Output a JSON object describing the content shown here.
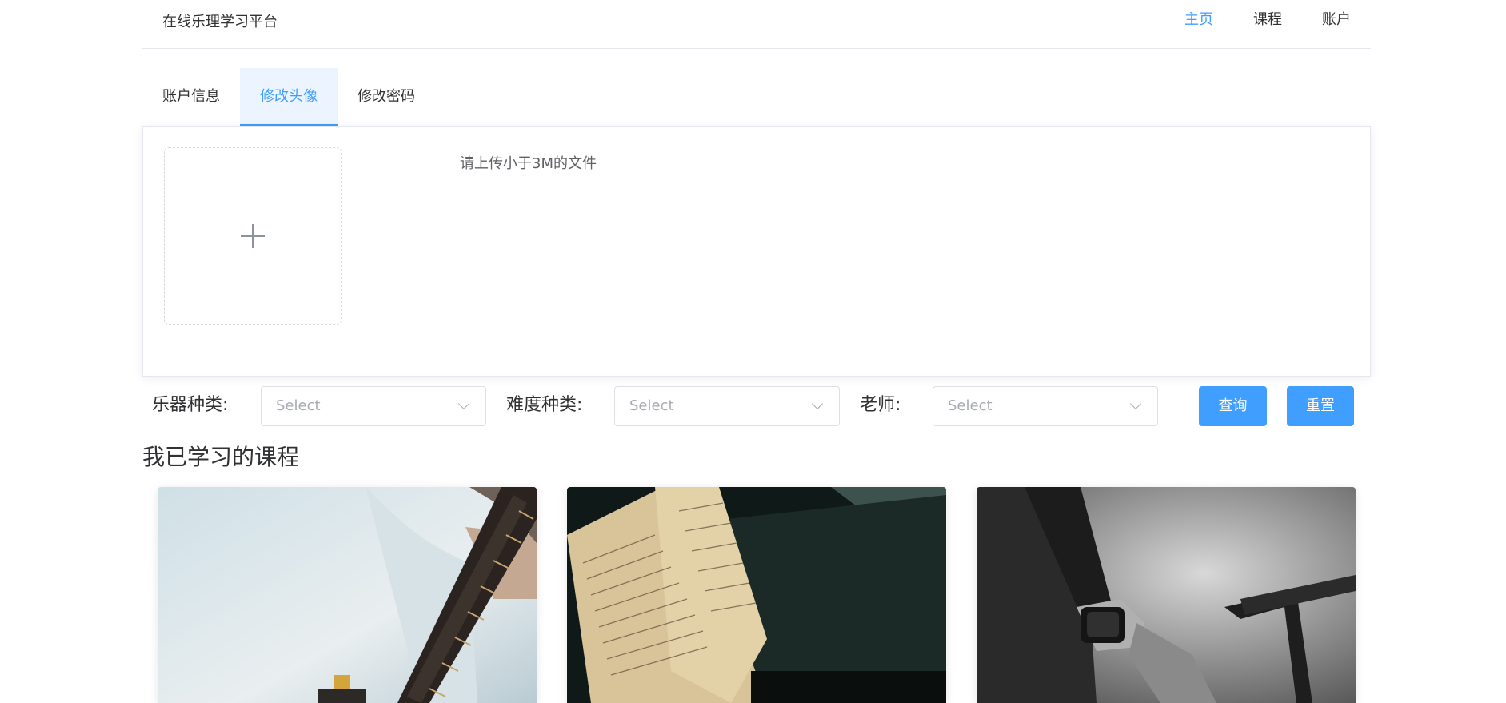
{
  "header": {
    "brand": "在线乐理学习平台",
    "nav": [
      "主页",
      "课程",
      "账户"
    ]
  },
  "tabs": [
    "账户信息",
    "修改头像",
    "修改密码"
  ],
  "upload": {
    "hint": "请上传小于3M的文件"
  },
  "filters": {
    "instrument_label": "乐器种类:",
    "difficulty_label": "难度种类:",
    "teacher_label": "老师:",
    "placeholder": "Select",
    "search_button": "查询",
    "reset_button": "重置"
  },
  "section_title": "我已学习的课程",
  "colors": {
    "accent": "#409eff",
    "accent_light": "#ecf5ff"
  }
}
